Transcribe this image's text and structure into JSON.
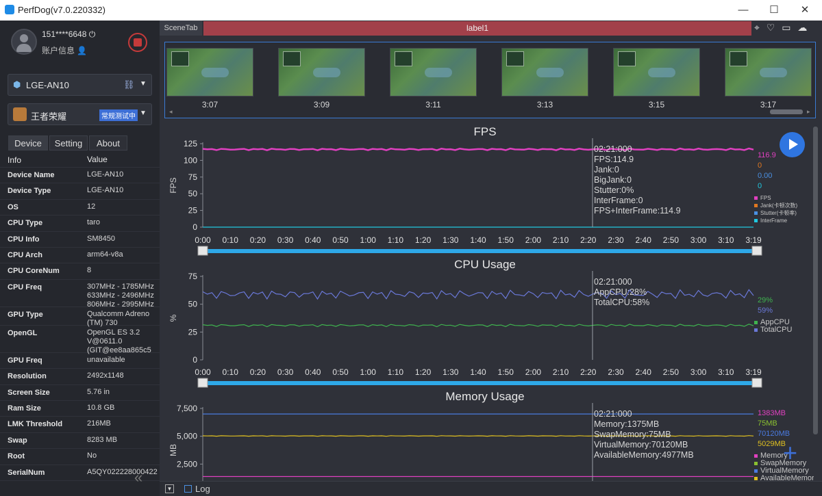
{
  "window": {
    "title": "PerfDog(v7.0.220332)",
    "minimize": "—",
    "maximize": "☐",
    "close": "✕"
  },
  "user": {
    "name": "151****6648",
    "account": "账户信息"
  },
  "device": {
    "name": "LGE-AN10"
  },
  "app": {
    "name": "王者荣耀",
    "badge": "常规测试中"
  },
  "tabs": [
    "Device",
    "Setting",
    "About"
  ],
  "info": {
    "header": [
      "Info",
      "Value"
    ],
    "rows": [
      {
        "k": "Device Name",
        "v": "LGE-AN10"
      },
      {
        "k": "Device Type",
        "v": "LGE-AN10"
      },
      {
        "k": "OS",
        "v": "12"
      },
      {
        "k": "CPU Type",
        "v": "taro"
      },
      {
        "k": "CPU Info",
        "v": "SM8450"
      },
      {
        "k": "CPU Arch",
        "v": "arm64-v8a"
      },
      {
        "k": "CPU CoreNum",
        "v": "8"
      },
      {
        "k": "CPU Freq",
        "v": "307MHz - 1785MHz 633MHz - 2496MHz 806MHz - 2995MHz"
      },
      {
        "k": "GPU Type",
        "v": "Qualcomm Adreno (TM) 730"
      },
      {
        "k": "OpenGL",
        "v": "OpenGL ES 3.2 V@0611.0 (GIT@ee8aa865c5"
      },
      {
        "k": "GPU Freq",
        "v": "unavailable"
      },
      {
        "k": "Resolution",
        "v": "2492x1148"
      },
      {
        "k": "Screen Size",
        "v": "5.76 in"
      },
      {
        "k": "Ram Size",
        "v": "10.8 GB"
      },
      {
        "k": "LMK Threshold",
        "v": "216MB"
      },
      {
        "k": "Swap",
        "v": "8283 MB"
      },
      {
        "k": "Root",
        "v": "No"
      },
      {
        "k": "SerialNum",
        "v": "A5QY022228000422"
      }
    ]
  },
  "scene": {
    "tab": "SceneTab",
    "label": "label1"
  },
  "thumbnails": [
    "3:07",
    "3:09",
    "3:11",
    "3:13",
    "3:15",
    "3:17"
  ],
  "xticks": [
    "0:00",
    "0:10",
    "0:20",
    "0:30",
    "0:40",
    "0:50",
    "1:00",
    "1:10",
    "1:20",
    "1:30",
    "1:40",
    "1:50",
    "2:00",
    "2:10",
    "2:20",
    "2:30",
    "2:40",
    "2:50",
    "3:00",
    "3:10",
    "3:19"
  ],
  "fps": {
    "title": "FPS",
    "ylabel": "FPS",
    "yticks": [
      "125",
      "100",
      "75",
      "50",
      "25",
      "0"
    ],
    "annotation": [
      "02:21:000",
      "FPS:114.9",
      "Jank:0",
      "BigJank:0",
      "Stutter:0%",
      "InterFrame:0",
      "FPS+InterFrame:114.9"
    ],
    "values": [
      "116.9",
      "0",
      "0.00",
      "0"
    ],
    "legend": [
      "FPS",
      "Jank(卡顿次数)",
      "Stutter(卡顿率)",
      "InterFrame"
    ]
  },
  "cpu": {
    "title": "CPU Usage",
    "ylabel": "%",
    "yticks": [
      "75",
      "50",
      "25",
      "0"
    ],
    "annotation": [
      "02:21:000",
      "AppCPU:28%",
      "TotalCPU:58%"
    ],
    "values": [
      "29%",
      "59%"
    ],
    "legend": [
      "AppCPU",
      "TotalCPU"
    ]
  },
  "memory": {
    "title": "Memory Usage",
    "ylabel": "MB",
    "yticks": [
      "7,500",
      "5,000",
      "2,500"
    ],
    "annotation": [
      "02:21:000",
      "Memory:1375MB",
      "SwapMemory:75MB",
      "VirtualMemory:70120MB",
      "AvailableMemory:4977MB"
    ],
    "values": [
      "1383MB",
      "75MB",
      "70120MB",
      "5029MB"
    ],
    "legend": [
      "Memory",
      "SwapMemory",
      "VirtualMemory",
      "AvailableMemory"
    ]
  },
  "colors": {
    "fps": "#e040c0",
    "jank": "#e07820",
    "stutter": "#4a90e2",
    "interframe": "#20c8e0",
    "appcpu": "#3fb34f",
    "totalcpu": "#6a78d8",
    "memory": "#e040c0",
    "swap": "#8ac030",
    "virtual": "#4a7ae0",
    "available": "#e0c020"
  },
  "bottom": {
    "log": "Log"
  },
  "chart_data": [
    {
      "type": "line",
      "title": "FPS",
      "ylabel": "FPS",
      "ylim": [
        0,
        125
      ],
      "x": "0:00-3:19",
      "series": [
        {
          "name": "FPS",
          "values": [
            116.9
          ]
        },
        {
          "name": "InterFrame",
          "values": [
            0
          ]
        }
      ]
    },
    {
      "type": "line",
      "title": "CPU Usage",
      "ylabel": "%",
      "ylim": [
        0,
        75
      ],
      "series": [
        {
          "name": "AppCPU",
          "values": [
            28
          ]
        },
        {
          "name": "TotalCPU",
          "values": [
            58
          ]
        }
      ]
    },
    {
      "type": "line",
      "title": "Memory Usage",
      "ylabel": "MB",
      "ylim": [
        0,
        7500
      ],
      "series": [
        {
          "name": "Memory",
          "values": [
            1375
          ]
        },
        {
          "name": "VirtualMemory",
          "values": [
            70120
          ]
        },
        {
          "name": "AvailableMemory",
          "values": [
            4977
          ]
        }
      ]
    }
  ]
}
